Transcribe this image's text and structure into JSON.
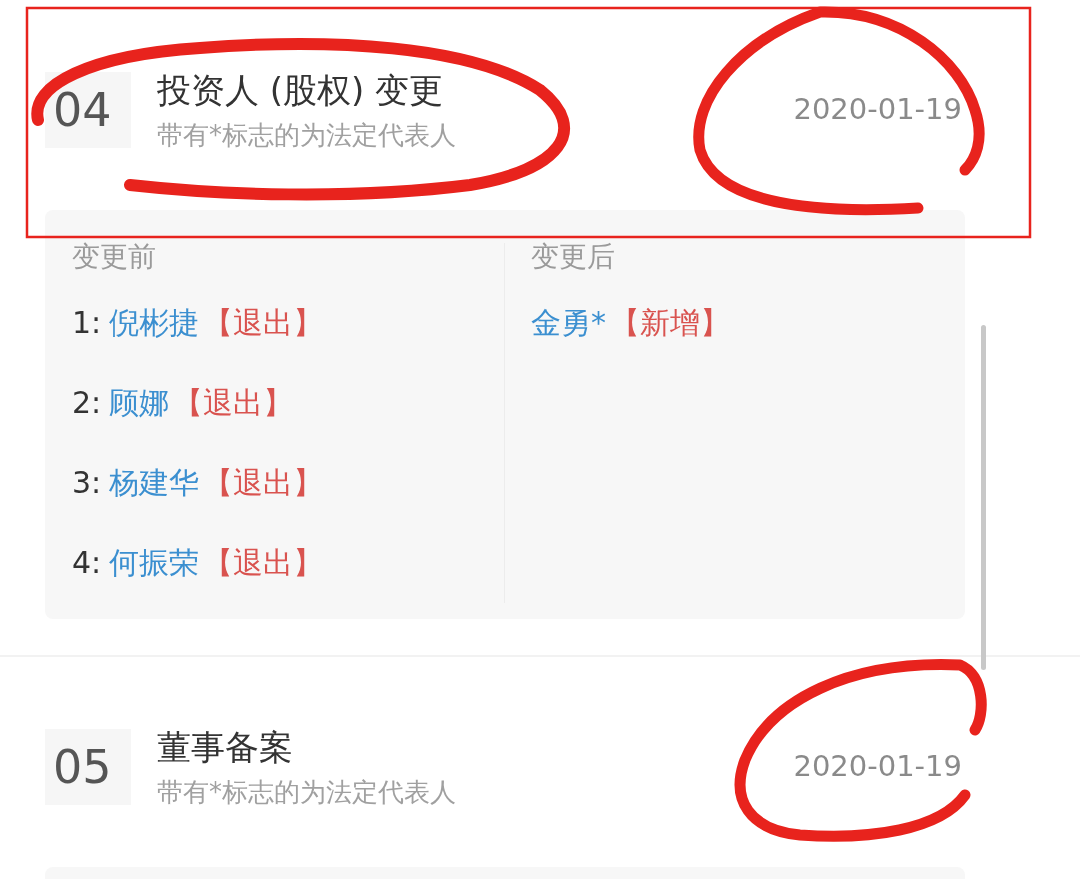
{
  "records": [
    {
      "number": "04",
      "title": "投资人 (股权) 变更",
      "note": "带有*标志的为法定代表人",
      "date": "2020-01-19",
      "details": {
        "before_heading": "变更前",
        "after_heading": "变更后",
        "before": [
          {
            "index": "1:",
            "name": "倪彬捷",
            "tag": "【退出】"
          },
          {
            "index": "2:",
            "name": "顾娜",
            "tag": "【退出】"
          },
          {
            "index": "3:",
            "name": "杨建华",
            "tag": "【退出】"
          },
          {
            "index": "4:",
            "name": "何振荣",
            "tag": "【退出】"
          }
        ],
        "after": [
          {
            "name": "金勇*",
            "tag": "【新增】"
          }
        ]
      }
    },
    {
      "number": "05",
      "title": "董事备案",
      "note": "带有*标志的为法定代表人",
      "date": "2020-01-19"
    }
  ]
}
